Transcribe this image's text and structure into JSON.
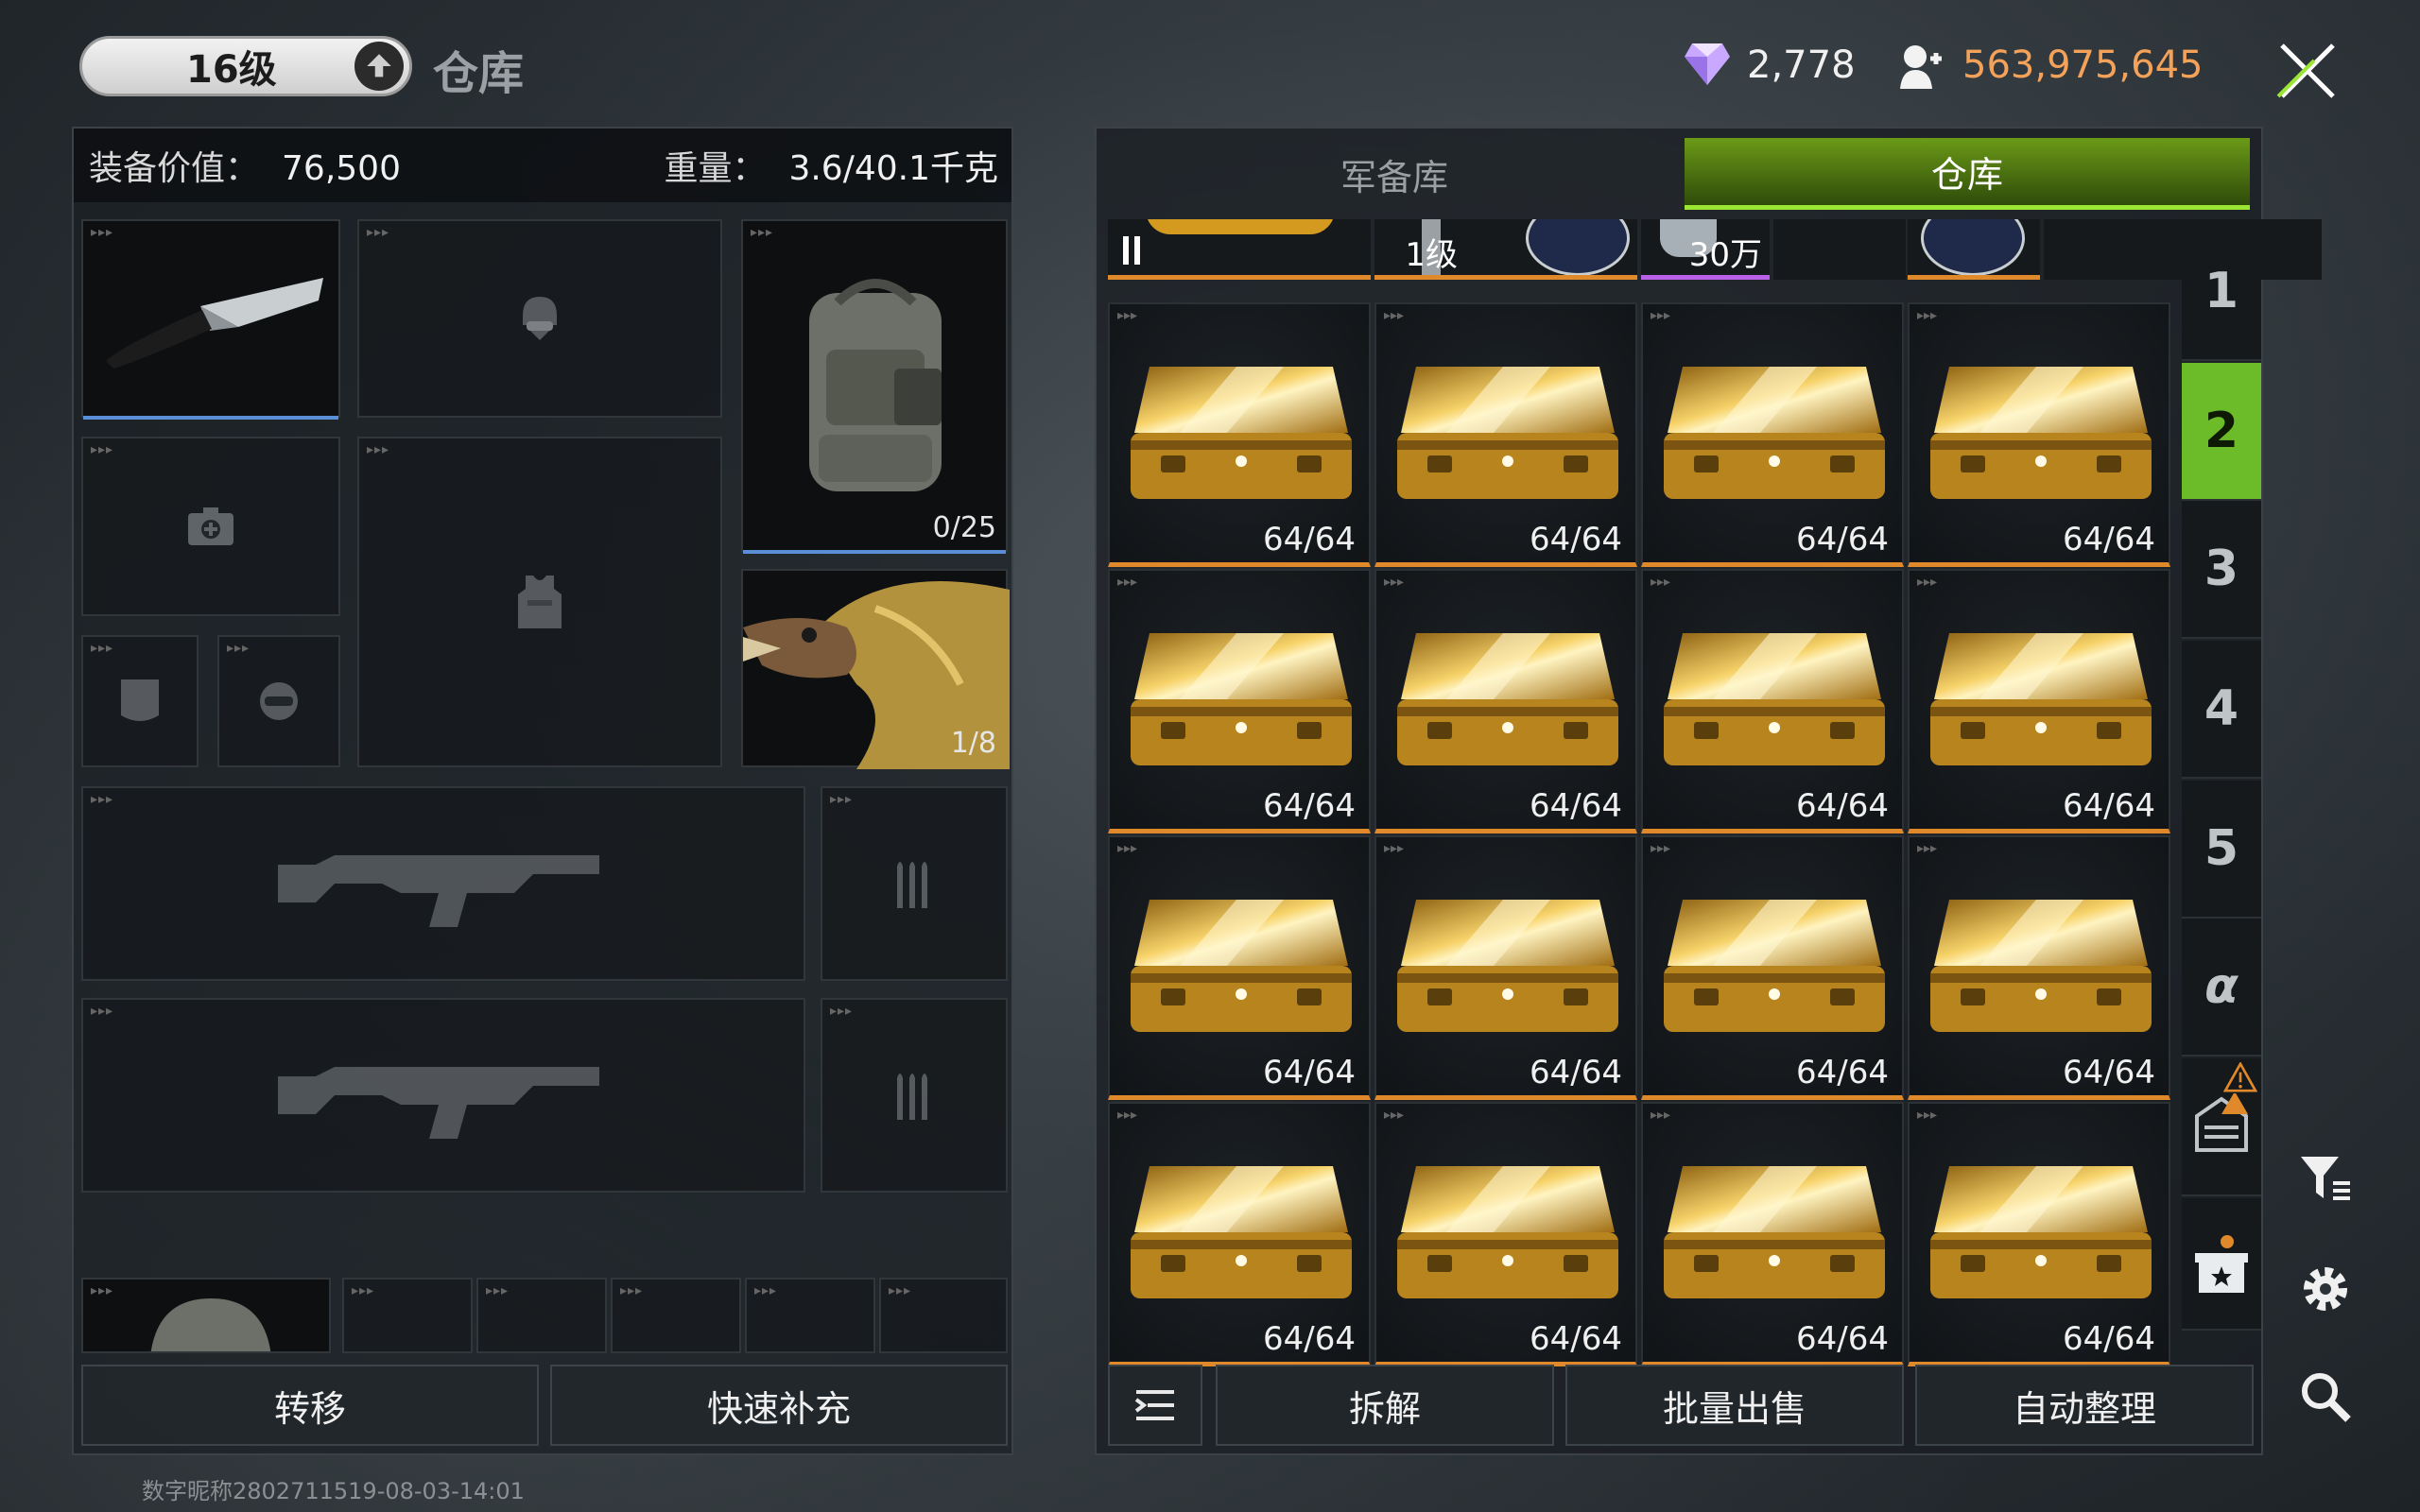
{
  "header": {
    "level_label": "16级",
    "title": "仓库",
    "gems": "2,778",
    "coins": "563,975,645",
    "coin_color": "#f4a25a"
  },
  "loadout": {
    "value_label": "装备价值：",
    "value": "76,500",
    "weight_label": "重量：",
    "weight": "3.6/40.1千克",
    "backpack_capacity": "0/25",
    "armor_capacity": "1/8"
  },
  "left_buttons": {
    "transfer": "转移",
    "quick_refill": "快速补充"
  },
  "footer_note": "数字昵称2802711519-08-03-14:01",
  "storage": {
    "tabs": [
      {
        "label": "军备库",
        "active": false
      },
      {
        "label": "仓库",
        "active": true
      }
    ],
    "strip": [
      {
        "text": ""
      },
      {
        "text": "1级"
      },
      {
        "text": "30万"
      },
      {
        "text": ""
      },
      {
        "text": ""
      }
    ],
    "items": [
      {
        "name": "gold-case",
        "qty": "64/64"
      },
      {
        "name": "gold-case",
        "qty": "64/64"
      },
      {
        "name": "gold-case",
        "qty": "64/64"
      },
      {
        "name": "gold-case",
        "qty": "64/64"
      },
      {
        "name": "gold-case",
        "qty": "64/64"
      },
      {
        "name": "gold-case",
        "qty": "64/64"
      },
      {
        "name": "gold-case",
        "qty": "64/64"
      },
      {
        "name": "gold-case",
        "qty": "64/64"
      },
      {
        "name": "gold-case",
        "qty": "64/64"
      },
      {
        "name": "gold-case",
        "qty": "64/64"
      },
      {
        "name": "gold-case",
        "qty": "64/64"
      },
      {
        "name": "gold-case",
        "qty": "64/64"
      },
      {
        "name": "gold-case",
        "qty": "64/64"
      },
      {
        "name": "gold-case",
        "qty": "64/64"
      },
      {
        "name": "gold-case",
        "qty": "64/64"
      },
      {
        "name": "gold-case",
        "qty": "64/64"
      }
    ],
    "pages": [
      "1",
      "2",
      "3",
      "4",
      "5",
      "α"
    ],
    "active_page": "2",
    "actions": {
      "dismantle": "拆解",
      "bulk_sell": "批量出售",
      "auto_sort": "自动整理"
    }
  },
  "side_icons": [
    "filter-icon",
    "gear-icon",
    "search-icon"
  ]
}
